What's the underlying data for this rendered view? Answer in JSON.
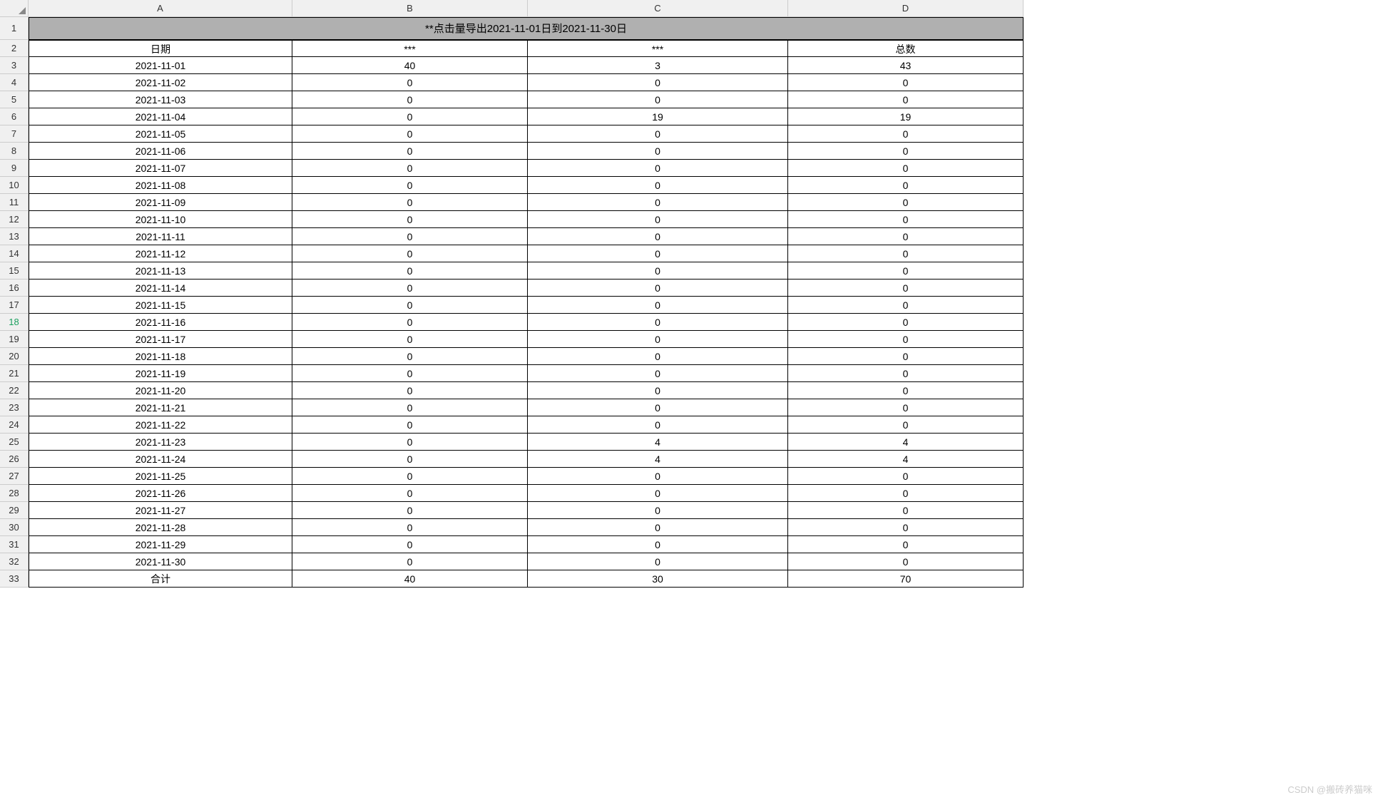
{
  "columns": [
    "A",
    "B",
    "C",
    "D"
  ],
  "title": "**点击量导出2021-11-01日到2021-11-30日",
  "headers": {
    "a": "日期",
    "b": "***",
    "c": "***",
    "d": "总数"
  },
  "rows": [
    {
      "n": "3",
      "a": "2021-11-01",
      "b": "40",
      "c": "3",
      "d": "43"
    },
    {
      "n": "4",
      "a": "2021-11-02",
      "b": "0",
      "c": "0",
      "d": "0"
    },
    {
      "n": "5",
      "a": "2021-11-03",
      "b": "0",
      "c": "0",
      "d": "0"
    },
    {
      "n": "6",
      "a": "2021-11-04",
      "b": "0",
      "c": "19",
      "d": "19"
    },
    {
      "n": "7",
      "a": "2021-11-05",
      "b": "0",
      "c": "0",
      "d": "0"
    },
    {
      "n": "8",
      "a": "2021-11-06",
      "b": "0",
      "c": "0",
      "d": "0"
    },
    {
      "n": "9",
      "a": "2021-11-07",
      "b": "0",
      "c": "0",
      "d": "0"
    },
    {
      "n": "10",
      "a": "2021-11-08",
      "b": "0",
      "c": "0",
      "d": "0"
    },
    {
      "n": "11",
      "a": "2021-11-09",
      "b": "0",
      "c": "0",
      "d": "0"
    },
    {
      "n": "12",
      "a": "2021-11-10",
      "b": "0",
      "c": "0",
      "d": "0"
    },
    {
      "n": "13",
      "a": "2021-11-11",
      "b": "0",
      "c": "0",
      "d": "0"
    },
    {
      "n": "14",
      "a": "2021-11-12",
      "b": "0",
      "c": "0",
      "d": "0"
    },
    {
      "n": "15",
      "a": "2021-11-13",
      "b": "0",
      "c": "0",
      "d": "0"
    },
    {
      "n": "16",
      "a": "2021-11-14",
      "b": "0",
      "c": "0",
      "d": "0"
    },
    {
      "n": "17",
      "a": "2021-11-15",
      "b": "0",
      "c": "0",
      "d": "0"
    },
    {
      "n": "18",
      "a": "2021-11-16",
      "b": "0",
      "c": "0",
      "d": "0"
    },
    {
      "n": "19",
      "a": "2021-11-17",
      "b": "0",
      "c": "0",
      "d": "0"
    },
    {
      "n": "20",
      "a": "2021-11-18",
      "b": "0",
      "c": "0",
      "d": "0"
    },
    {
      "n": "21",
      "a": "2021-11-19",
      "b": "0",
      "c": "0",
      "d": "0"
    },
    {
      "n": "22",
      "a": "2021-11-20",
      "b": "0",
      "c": "0",
      "d": "0"
    },
    {
      "n": "23",
      "a": "2021-11-21",
      "b": "0",
      "c": "0",
      "d": "0"
    },
    {
      "n": "24",
      "a": "2021-11-22",
      "b": "0",
      "c": "0",
      "d": "0"
    },
    {
      "n": "25",
      "a": "2021-11-23",
      "b": "0",
      "c": "4",
      "d": "4"
    },
    {
      "n": "26",
      "a": "2021-11-24",
      "b": "0",
      "c": "4",
      "d": "4"
    },
    {
      "n": "27",
      "a": "2021-11-25",
      "b": "0",
      "c": "0",
      "d": "0"
    },
    {
      "n": "28",
      "a": "2021-11-26",
      "b": "0",
      "c": "0",
      "d": "0"
    },
    {
      "n": "29",
      "a": "2021-11-27",
      "b": "0",
      "c": "0",
      "d": "0"
    },
    {
      "n": "30",
      "a": "2021-11-28",
      "b": "0",
      "c": "0",
      "d": "0"
    },
    {
      "n": "31",
      "a": "2021-11-29",
      "b": "0",
      "c": "0",
      "d": "0"
    },
    {
      "n": "32",
      "a": "2021-11-30",
      "b": "0",
      "c": "0",
      "d": "0"
    },
    {
      "n": "33",
      "a": "合计",
      "b": "40",
      "c": "30",
      "d": "70"
    }
  ],
  "selected_row": "18",
  "watermark": "CSDN @搬砖养猫咪",
  "row_labels": {
    "r1": "1",
    "r2": "2"
  }
}
